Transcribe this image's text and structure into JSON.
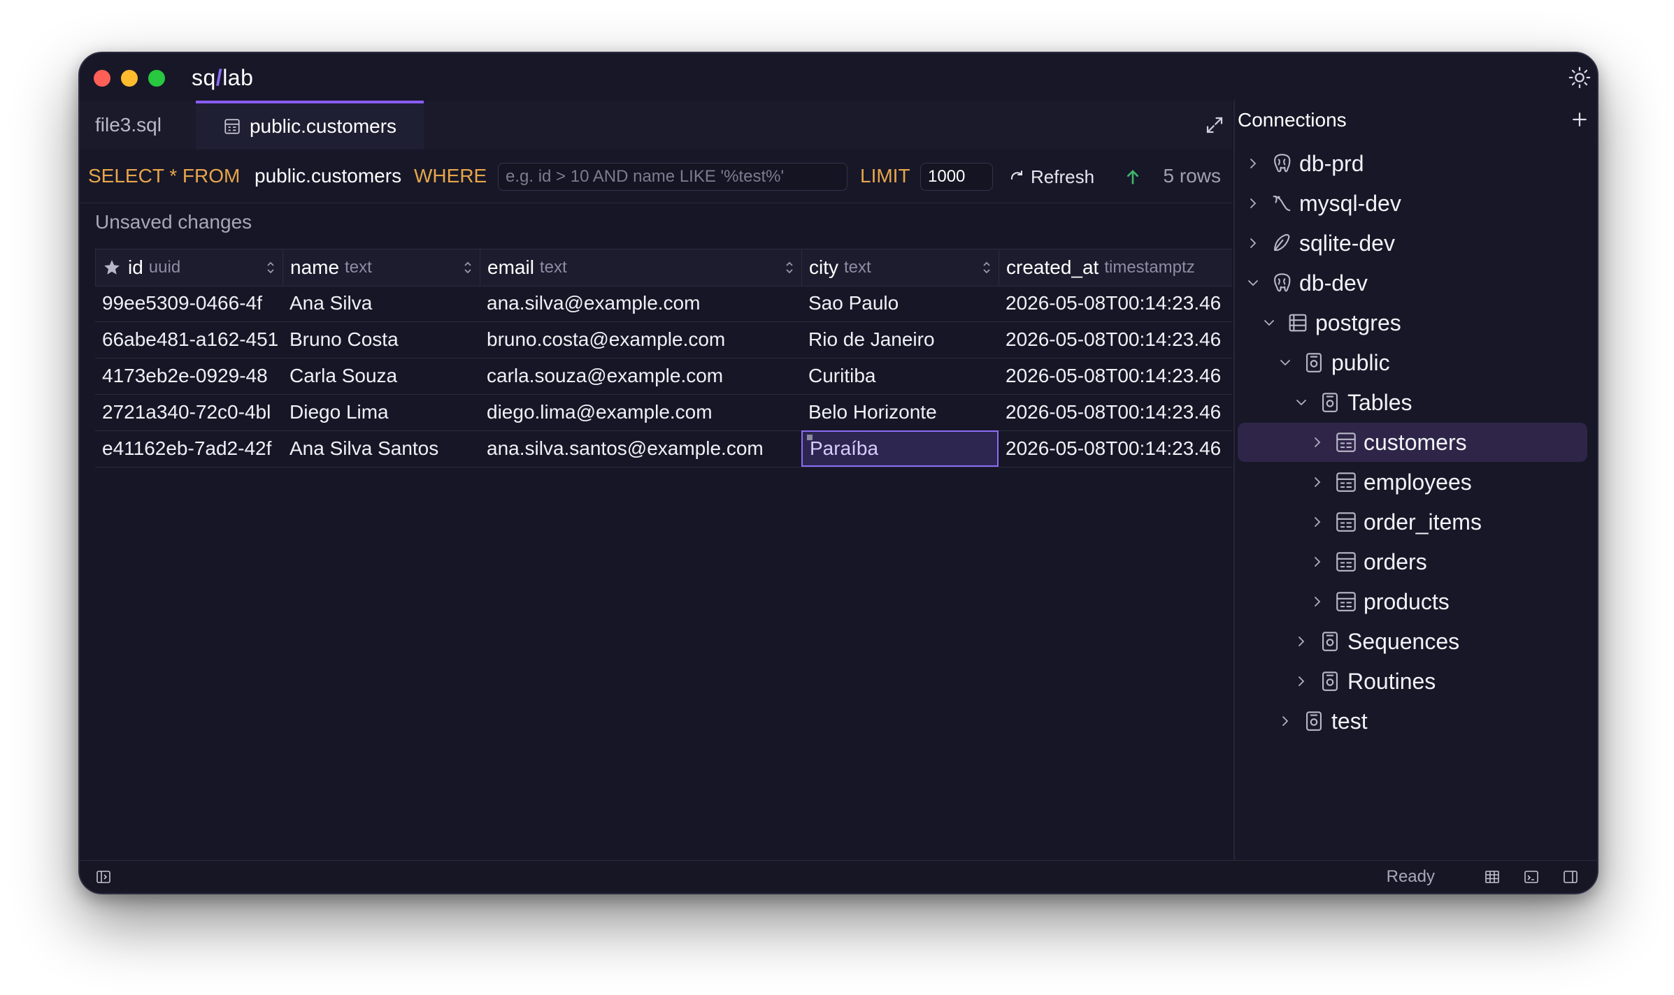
{
  "app": {
    "title_prefix": "sq",
    "title_slash": "/",
    "title_suffix": "lab"
  },
  "tabs": [
    {
      "label": "file3.sql"
    },
    {
      "label": "public.customers"
    }
  ],
  "query": {
    "select_kw": "SELECT * FROM",
    "table": "public.customers",
    "where_kw": "WHERE",
    "where_placeholder": "e.g. id > 10 AND name LIKE '%test%'",
    "limit_kw": "LIMIT",
    "limit_value": "1000",
    "refresh_label": "Refresh",
    "rows_count": "5 rows"
  },
  "unsaved_label": "Unsaved changes",
  "grid": {
    "columns": [
      {
        "name": "id",
        "type": "uuid"
      },
      {
        "name": "name",
        "type": "text"
      },
      {
        "name": "email",
        "type": "text"
      },
      {
        "name": "city",
        "type": "text"
      },
      {
        "name": "created_at",
        "type": "timestamptz"
      }
    ],
    "rows": [
      [
        "99ee5309-0466-4f",
        "Ana Silva",
        "ana.silva@example.com",
        "Sao Paulo",
        "2026-05-08T00:14:23.46"
      ],
      [
        "66abe481-a162-451",
        "Bruno Costa",
        "bruno.costa@example.com",
        "Rio de Janeiro",
        "2026-05-08T00:14:23.46"
      ],
      [
        "4173eb2e-0929-48",
        "Carla Souza",
        "carla.souza@example.com",
        "Curitiba",
        "2026-05-08T00:14:23.46"
      ],
      [
        "2721a340-72c0-4bl",
        "Diego Lima",
        "diego.lima@example.com",
        "Belo Horizonte",
        "2026-05-08T00:14:23.46"
      ],
      [
        "e41162eb-7ad2-42f",
        "Ana Silva Santos",
        "ana.silva.santos@example.com",
        "Paraíba",
        "2026-05-08T00:14:23.46"
      ]
    ]
  },
  "panel": {
    "title": "Connections",
    "tree": [
      {
        "label": "db-prd",
        "icon": "postgres-icon"
      },
      {
        "label": "mysql-dev",
        "icon": "mysql-icon"
      },
      {
        "label": "sqlite-dev",
        "icon": "sqlite-icon"
      },
      {
        "label": "db-dev",
        "icon": "postgres-icon"
      },
      {
        "label": "postgres",
        "icon": "database-icon"
      },
      {
        "label": "public",
        "icon": "schema-icon"
      },
      {
        "label": "Tables",
        "icon": "folder-icon"
      },
      {
        "label": "customers",
        "icon": "table-icon"
      },
      {
        "label": "employees",
        "icon": "table-icon"
      },
      {
        "label": "order_items",
        "icon": "table-icon"
      },
      {
        "label": "orders",
        "icon": "table-icon"
      },
      {
        "label": "products",
        "icon": "table-icon"
      },
      {
        "label": "Sequences",
        "icon": "folder-icon"
      },
      {
        "label": "Routines",
        "icon": "folder-icon"
      },
      {
        "label": "test",
        "icon": "schema-icon"
      }
    ]
  },
  "status": {
    "text": "Ready"
  },
  "colors": {
    "accent": "#8b5cf6",
    "keyword": "#e7a64a",
    "background": "#161626"
  }
}
